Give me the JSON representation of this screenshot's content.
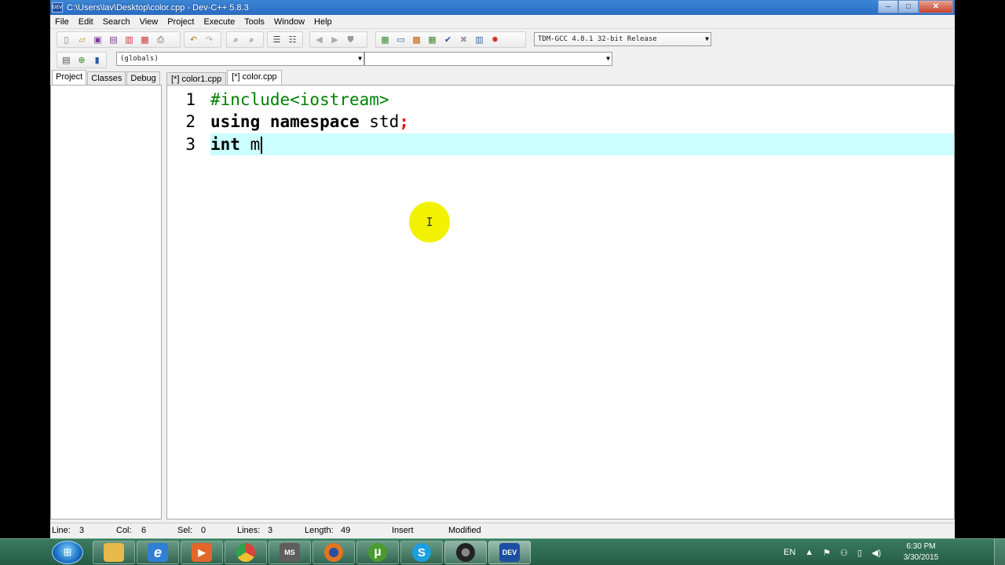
{
  "window": {
    "title": "C:\\Users\\lav\\Desktop\\color.cpp - Dev-C++ 5.8.3",
    "app_icon_text": "DEV",
    "controls": {
      "minimize": "–",
      "maximize": "□",
      "close": "✕"
    }
  },
  "menu": [
    "File",
    "Edit",
    "Search",
    "View",
    "Project",
    "Execute",
    "Tools",
    "Window",
    "Help"
  ],
  "toolbar": {
    "compiler_select": "TDM-GCC 4.8.1 32-bit Release",
    "scope_select": "(globals)",
    "member_select": ""
  },
  "left_panel": {
    "tabs": [
      "Project",
      "Classes",
      "Debug"
    ]
  },
  "editor_tabs": [
    "[*] color1.cpp",
    "[*] color.cpp"
  ],
  "editor": {
    "lines": [
      {
        "num": "1",
        "text": "#include<iostream>"
      },
      {
        "num": "2",
        "kw": "using namespace",
        "rest": " std",
        "sym": ";"
      },
      {
        "num": "3",
        "kw": "int",
        "rest": " m"
      }
    ],
    "mouse_cursor": "I"
  },
  "status": {
    "line_label": "Line:",
    "line_value": "3",
    "col_label": "Col:",
    "col_value": "6",
    "sel_label": "Sel:",
    "sel_value": "0",
    "lines_label": "Lines:",
    "lines_value": "3",
    "length_label": "Length:",
    "length_value": "49",
    "mode": "Insert",
    "state": "Modified"
  },
  "taskbar": {
    "language": "EN",
    "time": "6:30 PM",
    "date": "3/30/2015",
    "apps": [
      {
        "name": "explorer",
        "label": "",
        "color": "#e7b94a"
      },
      {
        "name": "internet-explorer",
        "label": "e",
        "color": "#2f7fd6"
      },
      {
        "name": "media-player",
        "label": "▶",
        "color": "#e2672a"
      },
      {
        "name": "chrome",
        "label": "",
        "color": "#d9443a"
      },
      {
        "name": "msconfig",
        "label": "MS",
        "color": "#5e5e5e"
      },
      {
        "name": "firefox",
        "label": "",
        "color": "#e2751f"
      },
      {
        "name": "utorrent",
        "label": "µ",
        "color": "#4a9b2f"
      },
      {
        "name": "skype",
        "label": "S",
        "color": "#1aa0e0"
      },
      {
        "name": "aperture-app",
        "label": "",
        "color": "#444444"
      },
      {
        "name": "devcpp",
        "label": "DEV",
        "color": "#1d4fa0"
      }
    ]
  }
}
